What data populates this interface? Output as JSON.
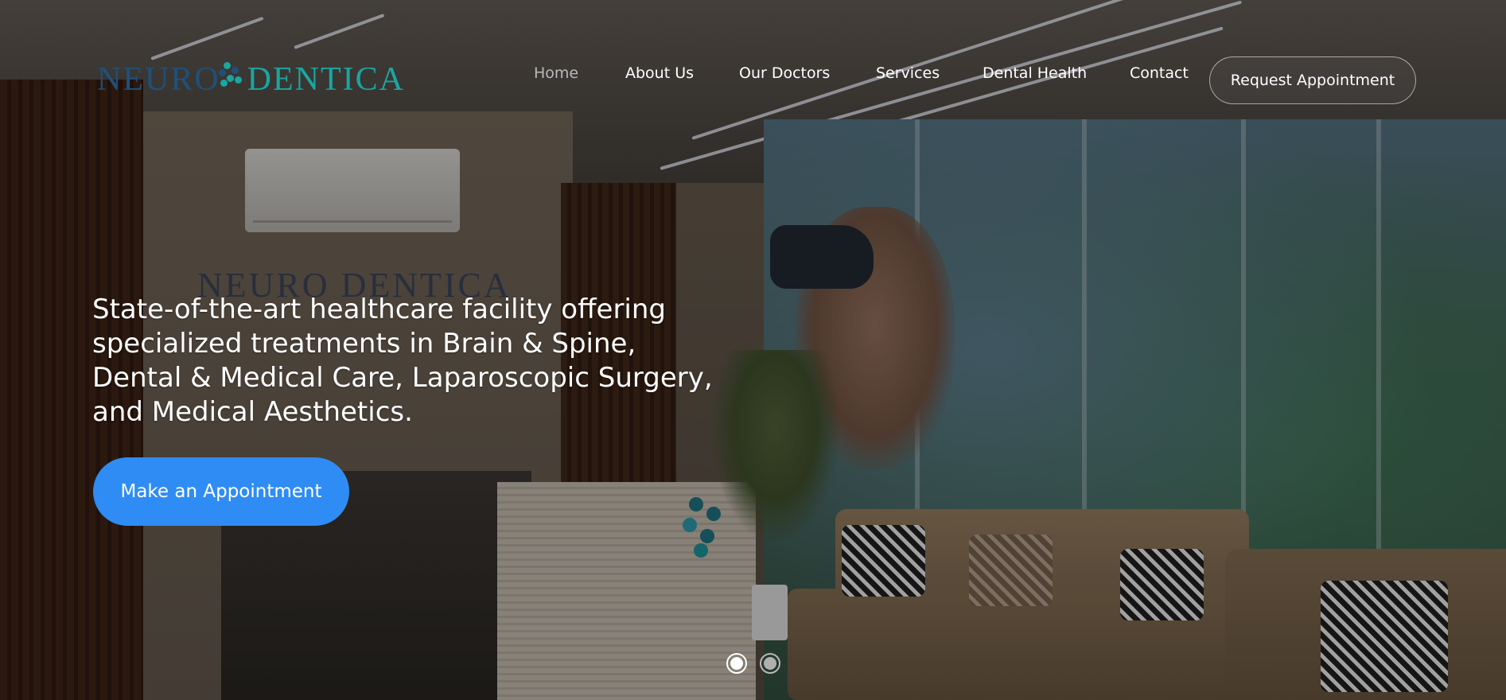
{
  "brand": {
    "name_part_a": "NEURO",
    "name_part_b": "DENTICA",
    "colors": {
      "navy": "#20507a",
      "teal": "#1aa6a2"
    }
  },
  "nav": {
    "items": [
      {
        "label": "Home",
        "active": true
      },
      {
        "label": "About Us",
        "active": false
      },
      {
        "label": "Our Doctors",
        "active": false
      },
      {
        "label": "Services",
        "active": false
      },
      {
        "label": "Dental Health",
        "active": false
      },
      {
        "label": "Contact",
        "active": false
      }
    ],
    "cta_label": "Request Appointment"
  },
  "hero": {
    "headline": "State-of-the-art healthcare facility offering specialized treatments in Brain & Spine, Dental & Medical Care, Laparoscopic Surgery, and Medical Aesthetics.",
    "button_label": "Make an Appointment",
    "button_color": "#2f8cf4",
    "background_icon": "clinic-reception-photo"
  },
  "carousel": {
    "slide_count": 2,
    "active_index": 0
  }
}
